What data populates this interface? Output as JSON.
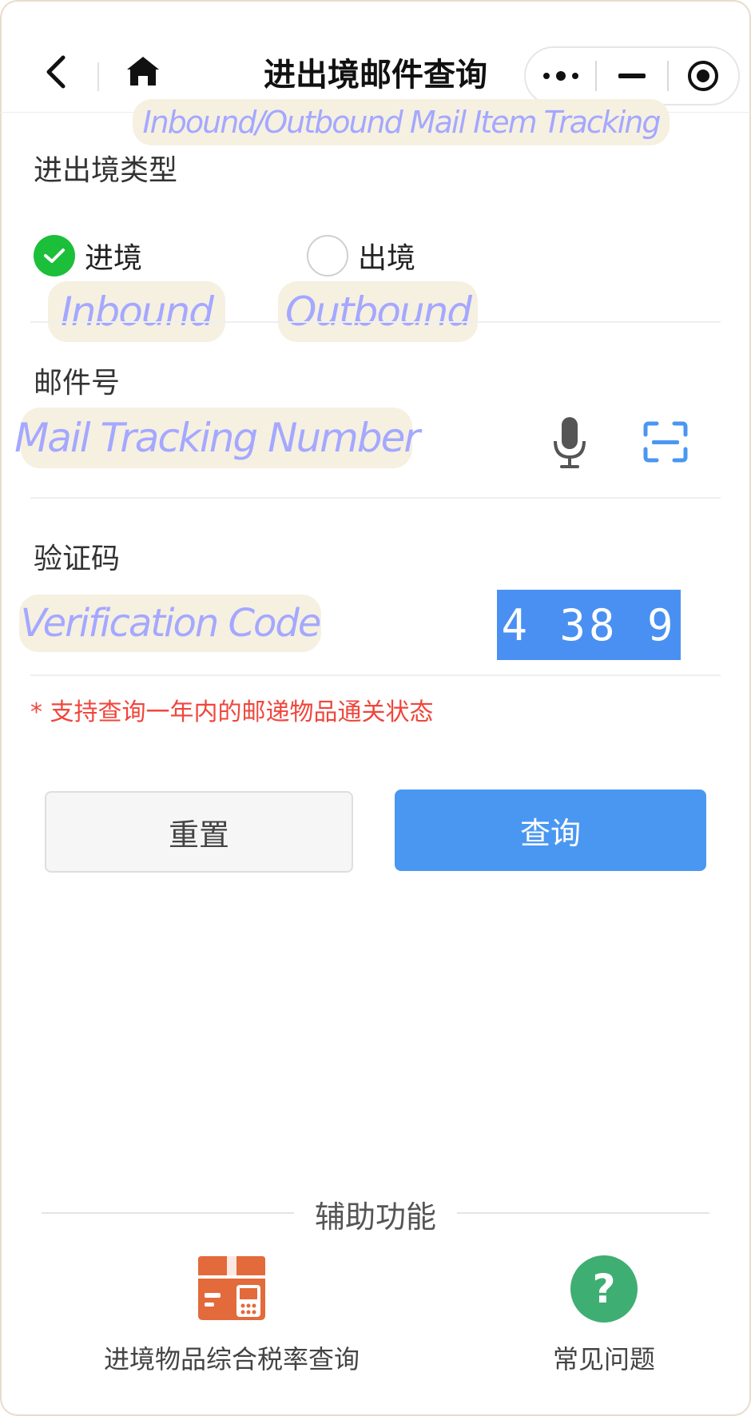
{
  "header": {
    "title": "进出境邮件查询",
    "title_annotation": "Inbound/Outbound Mail Item Tracking",
    "back_icon": "chevron-left-icon",
    "home_icon": "home-icon",
    "capsule": {
      "more_icon": "more-dots-icon",
      "minimize_icon": "minimize-icon",
      "close_icon": "target-close-icon"
    }
  },
  "form": {
    "type_section": {
      "label": "进出境类型",
      "options": [
        {
          "label": "进境",
          "annotation": "Inbound",
          "selected": true
        },
        {
          "label": "出境",
          "annotation": "Outbound",
          "selected": false
        }
      ]
    },
    "mail_number": {
      "label": "邮件号",
      "placeholder_annotation": "Mail Tracking Number",
      "voice_icon": "microphone-icon",
      "scan_icon": "scan-icon"
    },
    "captcha": {
      "label": "验证码",
      "placeholder_annotation": "Verification Code",
      "code": "4 38 9"
    },
    "tip": "* 支持查询一年内的邮递物品通关状态",
    "reset_label": "重置",
    "query_label": "查询"
  },
  "aux": {
    "title": "辅助功能",
    "items": [
      {
        "label": "进境物品综合税率查询",
        "icon": "tax-box-icon"
      },
      {
        "label": "常见问题",
        "icon": "question-icon"
      }
    ]
  },
  "colors": {
    "accent": "#4a97f2",
    "selected": "#1bbf3a",
    "tip": "#f0463c",
    "annotation": "#a4a8ff",
    "annotation_bg": "#f6f0e1",
    "aux_orange": "#e36a3b",
    "help_green": "#3fae72"
  }
}
